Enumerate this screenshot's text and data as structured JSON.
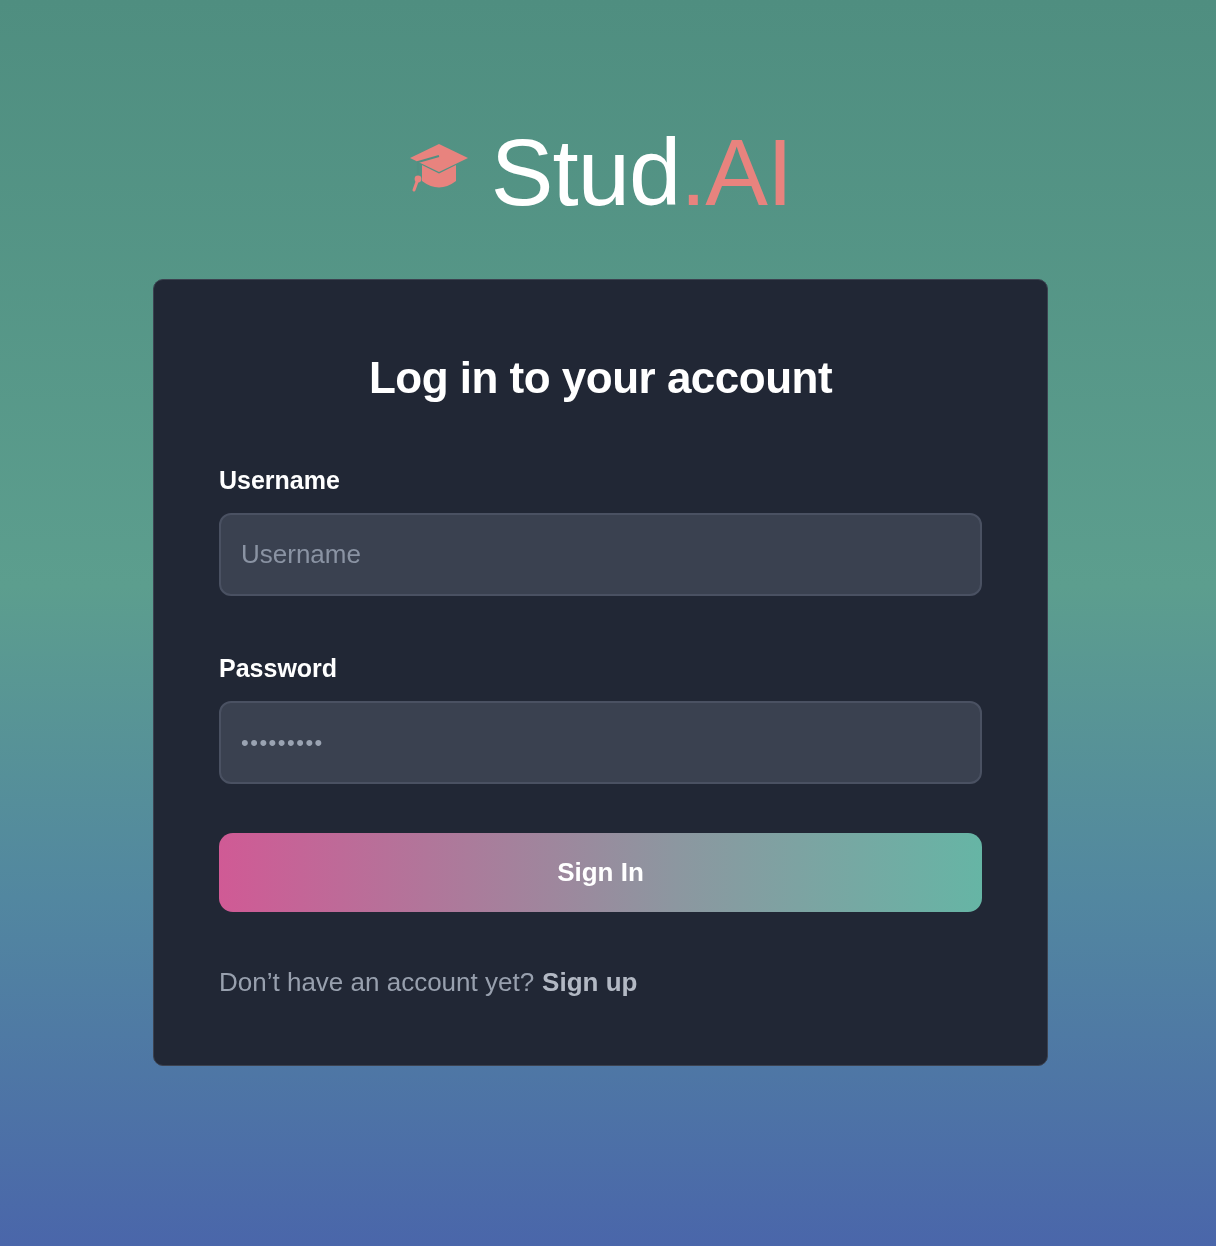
{
  "logo": {
    "text": "Stud",
    "accent": ".AI"
  },
  "card": {
    "title": "Log in to your account",
    "fields": [
      {
        "kind": "text",
        "label": "Username",
        "placeholder": "Username"
      },
      {
        "kind": "password",
        "label": "Password",
        "value": "•••••••••"
      }
    ],
    "submit_button": "Sign In",
    "footer": {
      "prompt": "Don’t have an account yet?",
      "link": "Sign up"
    }
  }
}
